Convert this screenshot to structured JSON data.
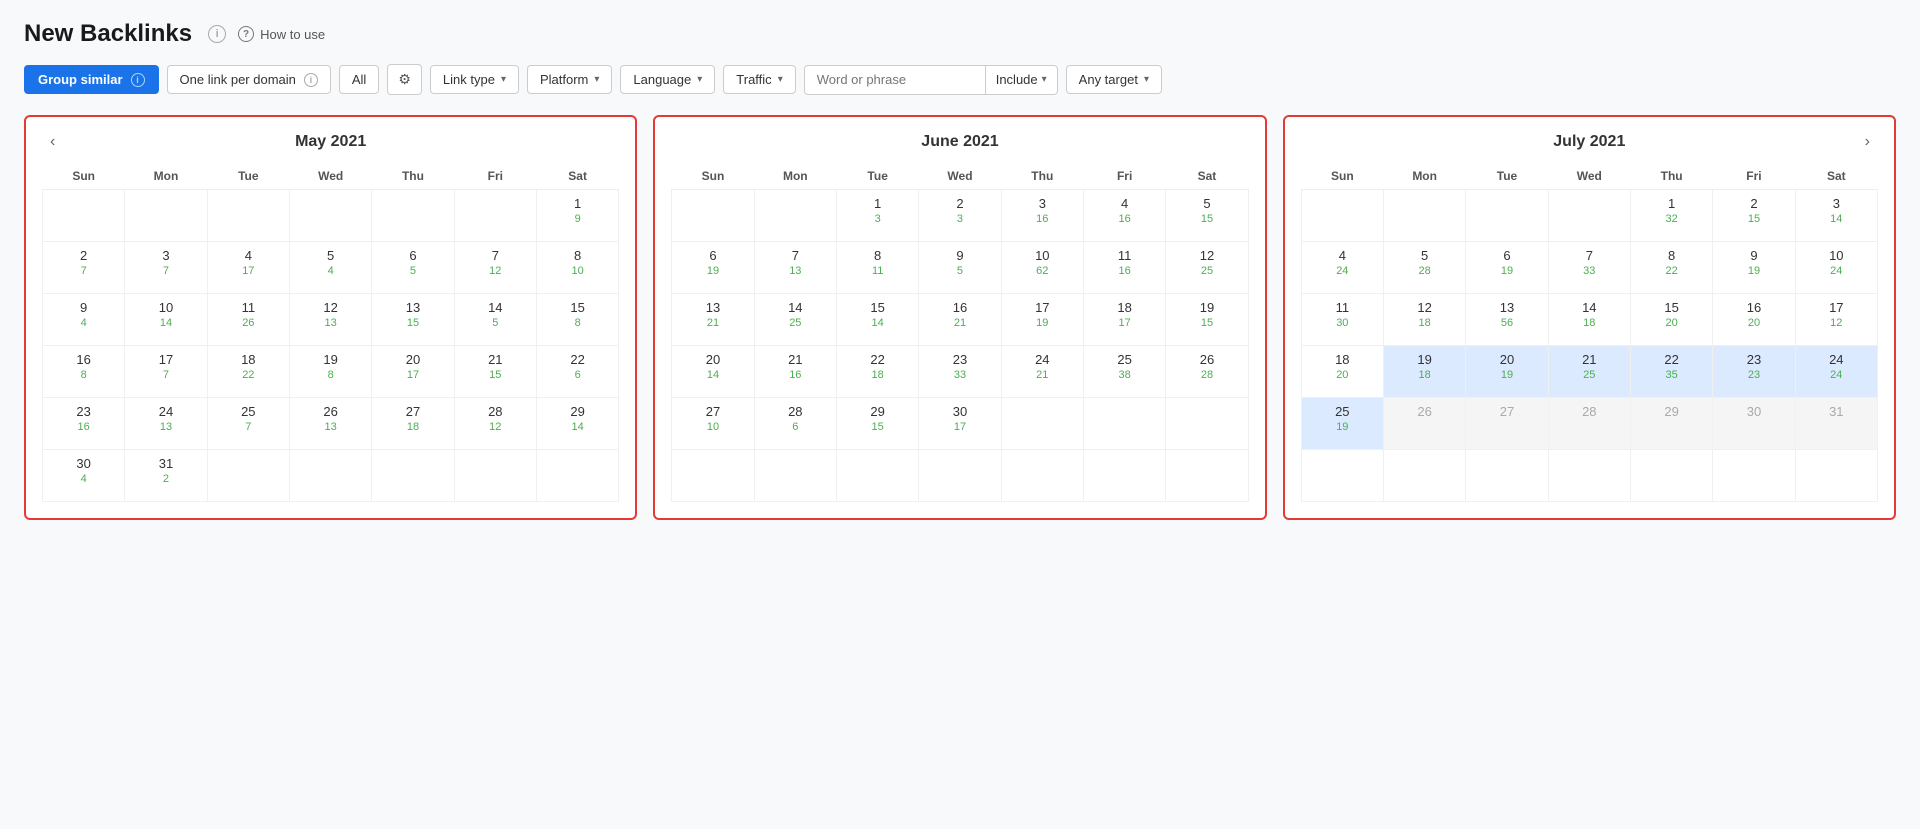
{
  "page": {
    "title": "New Backlinks",
    "how_to_use": "How to use"
  },
  "toolbar": {
    "group_similar": "Group similar",
    "one_link_per_domain": "One link per domain",
    "all_label": "All",
    "link_type": "Link type",
    "platform": "Platform",
    "language": "Language",
    "traffic": "Traffic",
    "word_or_phrase_placeholder": "Word or phrase",
    "include_label": "Include",
    "any_target": "Any target"
  },
  "calendars": [
    {
      "id": "may-2021",
      "title": "May 2021",
      "has_prev": true,
      "has_next": false,
      "days_of_week": [
        "Sun",
        "Mon",
        "Tue",
        "Wed",
        "Thu",
        "Fri",
        "Sat"
      ],
      "weeks": [
        [
          {
            "day": "",
            "count": ""
          },
          {
            "day": "",
            "count": ""
          },
          {
            "day": "",
            "count": ""
          },
          {
            "day": "",
            "count": ""
          },
          {
            "day": "",
            "count": ""
          },
          {
            "day": "",
            "count": ""
          },
          {
            "day": "1",
            "count": "9"
          }
        ],
        [
          {
            "day": "2",
            "count": "7"
          },
          {
            "day": "3",
            "count": "7"
          },
          {
            "day": "4",
            "count": "17"
          },
          {
            "day": "5",
            "count": "4"
          },
          {
            "day": "6",
            "count": "5"
          },
          {
            "day": "7",
            "count": "12"
          },
          {
            "day": "8",
            "count": "10"
          }
        ],
        [
          {
            "day": "9",
            "count": "4"
          },
          {
            "day": "10",
            "count": "14"
          },
          {
            "day": "11",
            "count": "26"
          },
          {
            "day": "12",
            "count": "13"
          },
          {
            "day": "13",
            "count": "15"
          },
          {
            "day": "14",
            "count": "5"
          },
          {
            "day": "15",
            "count": "8"
          }
        ],
        [
          {
            "day": "16",
            "count": "8"
          },
          {
            "day": "17",
            "count": "7"
          },
          {
            "day": "18",
            "count": "22"
          },
          {
            "day": "19",
            "count": "8"
          },
          {
            "day": "20",
            "count": "17"
          },
          {
            "day": "21",
            "count": "15"
          },
          {
            "day": "22",
            "count": "6"
          }
        ],
        [
          {
            "day": "23",
            "count": "16"
          },
          {
            "day": "24",
            "count": "13"
          },
          {
            "day": "25",
            "count": "7"
          },
          {
            "day": "26",
            "count": "13"
          },
          {
            "day": "27",
            "count": "18"
          },
          {
            "day": "28",
            "count": "12"
          },
          {
            "day": "29",
            "count": "14"
          }
        ],
        [
          {
            "day": "30",
            "count": "4"
          },
          {
            "day": "31",
            "count": "2"
          },
          {
            "day": "",
            "count": ""
          },
          {
            "day": "",
            "count": ""
          },
          {
            "day": "",
            "count": ""
          },
          {
            "day": "",
            "count": ""
          },
          {
            "day": "",
            "count": ""
          }
        ]
      ]
    },
    {
      "id": "june-2021",
      "title": "June 2021",
      "has_prev": false,
      "has_next": false,
      "days_of_week": [
        "Sun",
        "Mon",
        "Tue",
        "Wed",
        "Thu",
        "Fri",
        "Sat"
      ],
      "weeks": [
        [
          {
            "day": "",
            "count": ""
          },
          {
            "day": "",
            "count": ""
          },
          {
            "day": "1",
            "count": "3"
          },
          {
            "day": "2",
            "count": "3"
          },
          {
            "day": "3",
            "count": "16"
          },
          {
            "day": "4",
            "count": "16"
          },
          {
            "day": "5",
            "count": "15"
          }
        ],
        [
          {
            "day": "6",
            "count": "19"
          },
          {
            "day": "7",
            "count": "13"
          },
          {
            "day": "8",
            "count": "11"
          },
          {
            "day": "9",
            "count": "5"
          },
          {
            "day": "10",
            "count": "62"
          },
          {
            "day": "11",
            "count": "16"
          },
          {
            "day": "12",
            "count": "25"
          }
        ],
        [
          {
            "day": "13",
            "count": "21"
          },
          {
            "day": "14",
            "count": "25"
          },
          {
            "day": "15",
            "count": "14"
          },
          {
            "day": "16",
            "count": "21"
          },
          {
            "day": "17",
            "count": "19"
          },
          {
            "day": "18",
            "count": "17"
          },
          {
            "day": "19",
            "count": "15"
          }
        ],
        [
          {
            "day": "20",
            "count": "14"
          },
          {
            "day": "21",
            "count": "16"
          },
          {
            "day": "22",
            "count": "18"
          },
          {
            "day": "23",
            "count": "33"
          },
          {
            "day": "24",
            "count": "21"
          },
          {
            "day": "25",
            "count": "38"
          },
          {
            "day": "26",
            "count": "28"
          }
        ],
        [
          {
            "day": "27",
            "count": "10"
          },
          {
            "day": "28",
            "count": "6"
          },
          {
            "day": "29",
            "count": "15"
          },
          {
            "day": "30",
            "count": "17"
          },
          {
            "day": "",
            "count": ""
          },
          {
            "day": "",
            "count": ""
          },
          {
            "day": "",
            "count": ""
          }
        ],
        [
          {
            "day": "",
            "count": ""
          },
          {
            "day": "",
            "count": ""
          },
          {
            "day": "",
            "count": ""
          },
          {
            "day": "",
            "count": ""
          },
          {
            "day": "",
            "count": ""
          },
          {
            "day": "",
            "count": ""
          },
          {
            "day": "",
            "count": ""
          }
        ]
      ]
    },
    {
      "id": "july-2021",
      "title": "July 2021",
      "has_prev": false,
      "has_next": true,
      "days_of_week": [
        "Sun",
        "Mon",
        "Tue",
        "Wed",
        "Thu",
        "Fri",
        "Sat"
      ],
      "weeks": [
        [
          {
            "day": "",
            "count": ""
          },
          {
            "day": "",
            "count": ""
          },
          {
            "day": "",
            "count": ""
          },
          {
            "day": "",
            "count": ""
          },
          {
            "day": "1",
            "count": "32"
          },
          {
            "day": "2",
            "count": "15"
          },
          {
            "day": "3",
            "count": "14"
          }
        ],
        [
          {
            "day": "4",
            "count": "24"
          },
          {
            "day": "5",
            "count": "28"
          },
          {
            "day": "6",
            "count": "19"
          },
          {
            "day": "7",
            "count": "33"
          },
          {
            "day": "8",
            "count": "22"
          },
          {
            "day": "9",
            "count": "19"
          },
          {
            "day": "10",
            "count": "24"
          }
        ],
        [
          {
            "day": "11",
            "count": "30"
          },
          {
            "day": "12",
            "count": "18"
          },
          {
            "day": "13",
            "count": "56"
          },
          {
            "day": "14",
            "count": "18"
          },
          {
            "day": "15",
            "count": "20"
          },
          {
            "day": "16",
            "count": "20"
          },
          {
            "day": "17",
            "count": "12"
          }
        ],
        [
          {
            "day": "18",
            "count": "20",
            "highlight": false
          },
          {
            "day": "19",
            "count": "18",
            "highlight": true
          },
          {
            "day": "20",
            "count": "19",
            "highlight": true
          },
          {
            "day": "21",
            "count": "25",
            "highlight": true
          },
          {
            "day": "22",
            "count": "35",
            "highlight": true
          },
          {
            "day": "23",
            "count": "23",
            "highlight": true
          },
          {
            "day": "24",
            "count": "24",
            "highlight": true
          }
        ],
        [
          {
            "day": "25",
            "count": "19",
            "highlight": true
          },
          {
            "day": "26",
            "count": "",
            "grayed": true
          },
          {
            "day": "27",
            "count": "",
            "grayed": true
          },
          {
            "day": "28",
            "count": "",
            "grayed": true
          },
          {
            "day": "29",
            "count": "",
            "grayed": true
          },
          {
            "day": "30",
            "count": "",
            "grayed": true
          },
          {
            "day": "31",
            "count": "",
            "grayed": true
          }
        ],
        [
          {
            "day": "",
            "count": ""
          },
          {
            "day": "",
            "count": ""
          },
          {
            "day": "",
            "count": ""
          },
          {
            "day": "",
            "count": ""
          },
          {
            "day": "",
            "count": ""
          },
          {
            "day": "",
            "count": ""
          },
          {
            "day": "",
            "count": ""
          }
        ]
      ]
    }
  ]
}
